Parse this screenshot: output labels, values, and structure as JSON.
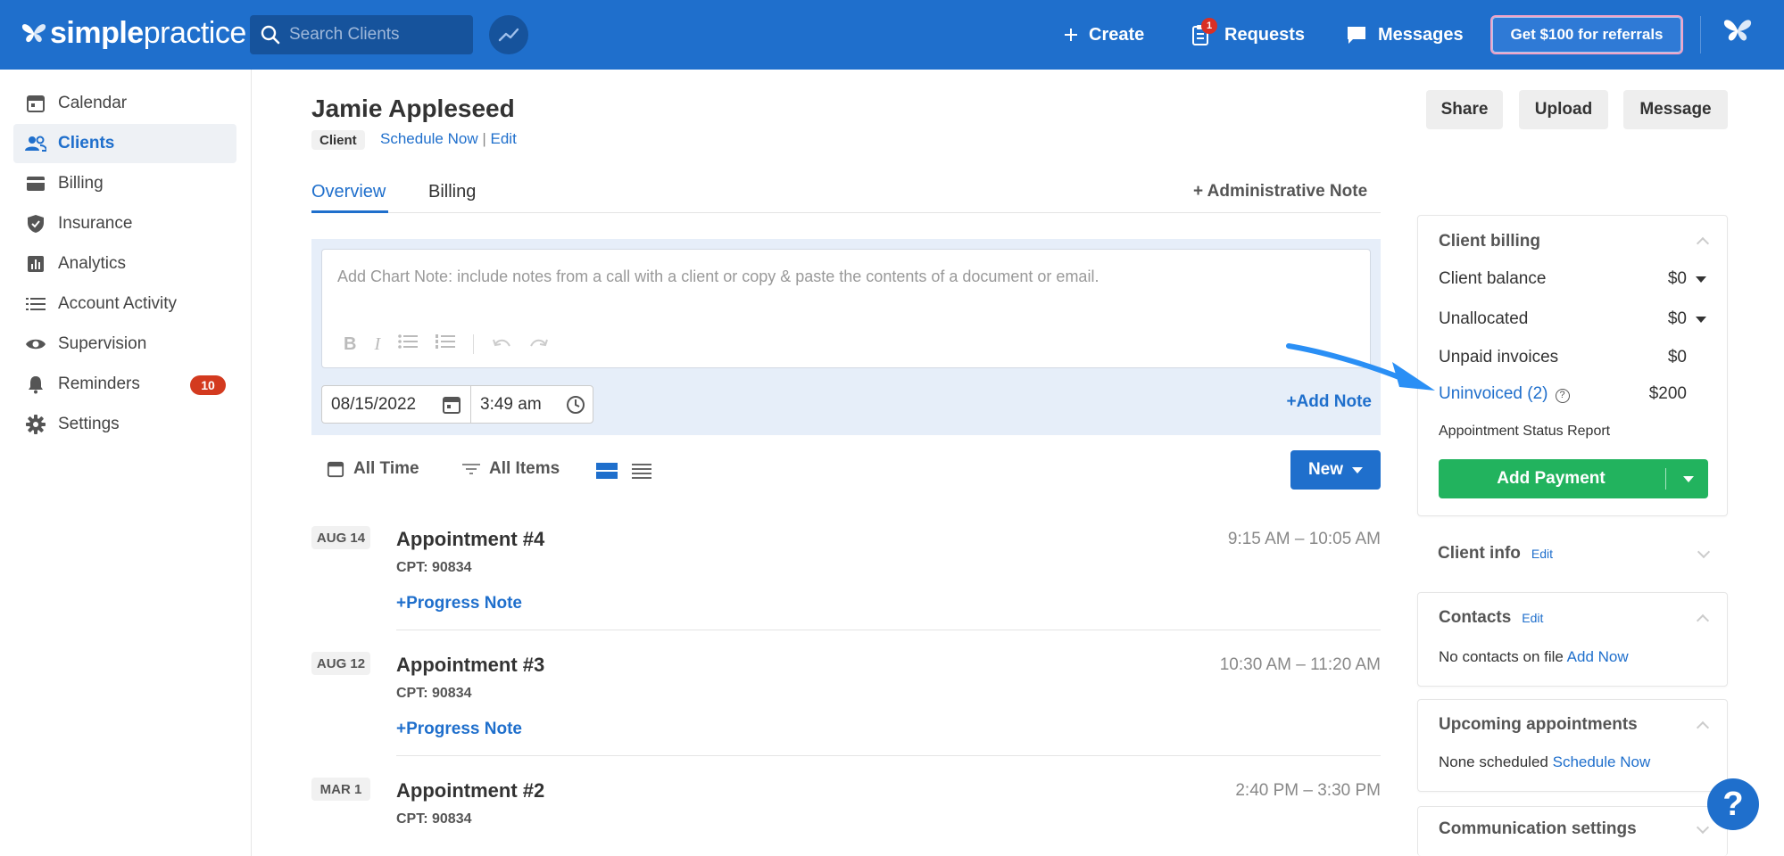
{
  "topbar": {
    "logo_bold": "simple",
    "logo_light": "practice",
    "search_placeholder": "Search Clients",
    "create_label": "Create",
    "requests_label": "Requests",
    "requests_badge": "1",
    "messages_label": "Messages",
    "referral_label": "Get $100 for referrals",
    "accent": "#1f6fcc"
  },
  "sidebar": {
    "items": [
      {
        "label": "Calendar",
        "icon": "calendar-icon"
      },
      {
        "label": "Clients",
        "icon": "clients-icon",
        "active": true
      },
      {
        "label": "Billing",
        "icon": "credit-card-icon"
      },
      {
        "label": "Insurance",
        "icon": "shield-icon"
      },
      {
        "label": "Analytics",
        "icon": "bar-chart-icon"
      },
      {
        "label": "Account Activity",
        "icon": "list-icon"
      },
      {
        "label": "Supervision",
        "icon": "eye-icon"
      },
      {
        "label": "Reminders",
        "icon": "bell-icon",
        "badge": "10"
      },
      {
        "label": "Settings",
        "icon": "gear-icon"
      }
    ]
  },
  "client": {
    "name": "Jamie Appleseed",
    "tag": "Client",
    "schedule_link": "Schedule Now",
    "edit_link": "Edit"
  },
  "actions": {
    "share": "Share",
    "upload": "Upload",
    "message": "Message"
  },
  "tabs": {
    "overview": "Overview",
    "billing": "Billing",
    "admin_note": "Administrative Note"
  },
  "note": {
    "placeholder": "Add Chart Note: include notes from a call with a client or copy & paste the contents of a document or email.",
    "date": "08/15/2022",
    "time": "3:49 am",
    "add_note": "Add Note"
  },
  "filters": {
    "time": "All Time",
    "items": "All Items",
    "new_label": "New"
  },
  "appointments": [
    {
      "date": "AUG 14",
      "title": "Appointment #4",
      "cpt": "CPT: 90834",
      "time": "9:15 AM – 10:05 AM",
      "progress": "Progress Note"
    },
    {
      "date": "AUG 12",
      "title": "Appointment #3",
      "cpt": "CPT: 90834",
      "time": "10:30 AM – 11:20 AM",
      "progress": "Progress Note"
    },
    {
      "date": "MAR 1",
      "title": "Appointment #2",
      "cpt": "CPT: 90834",
      "time": "2:40 PM – 3:30 PM"
    }
  ],
  "billing_card": {
    "title": "Client billing",
    "client_balance_label": "Client balance",
    "client_balance": "$0",
    "unallocated_label": "Unallocated",
    "unallocated": "$0",
    "unpaid_label": "Unpaid invoices",
    "unpaid": "$0",
    "uninvoiced_label": "Uninvoiced (2)",
    "uninvoiced": "$200",
    "status_report": "Appointment Status Report",
    "add_payment": "Add Payment"
  },
  "client_info": {
    "title": "Client info",
    "edit": "Edit"
  },
  "contacts": {
    "title": "Contacts",
    "edit": "Edit",
    "text": "No contacts on file",
    "link": "Add Now"
  },
  "upcoming": {
    "title": "Upcoming appointments",
    "text": "None scheduled",
    "link": "Schedule Now"
  },
  "communication": {
    "title": "Communication settings"
  },
  "help": {
    "label": "?"
  }
}
